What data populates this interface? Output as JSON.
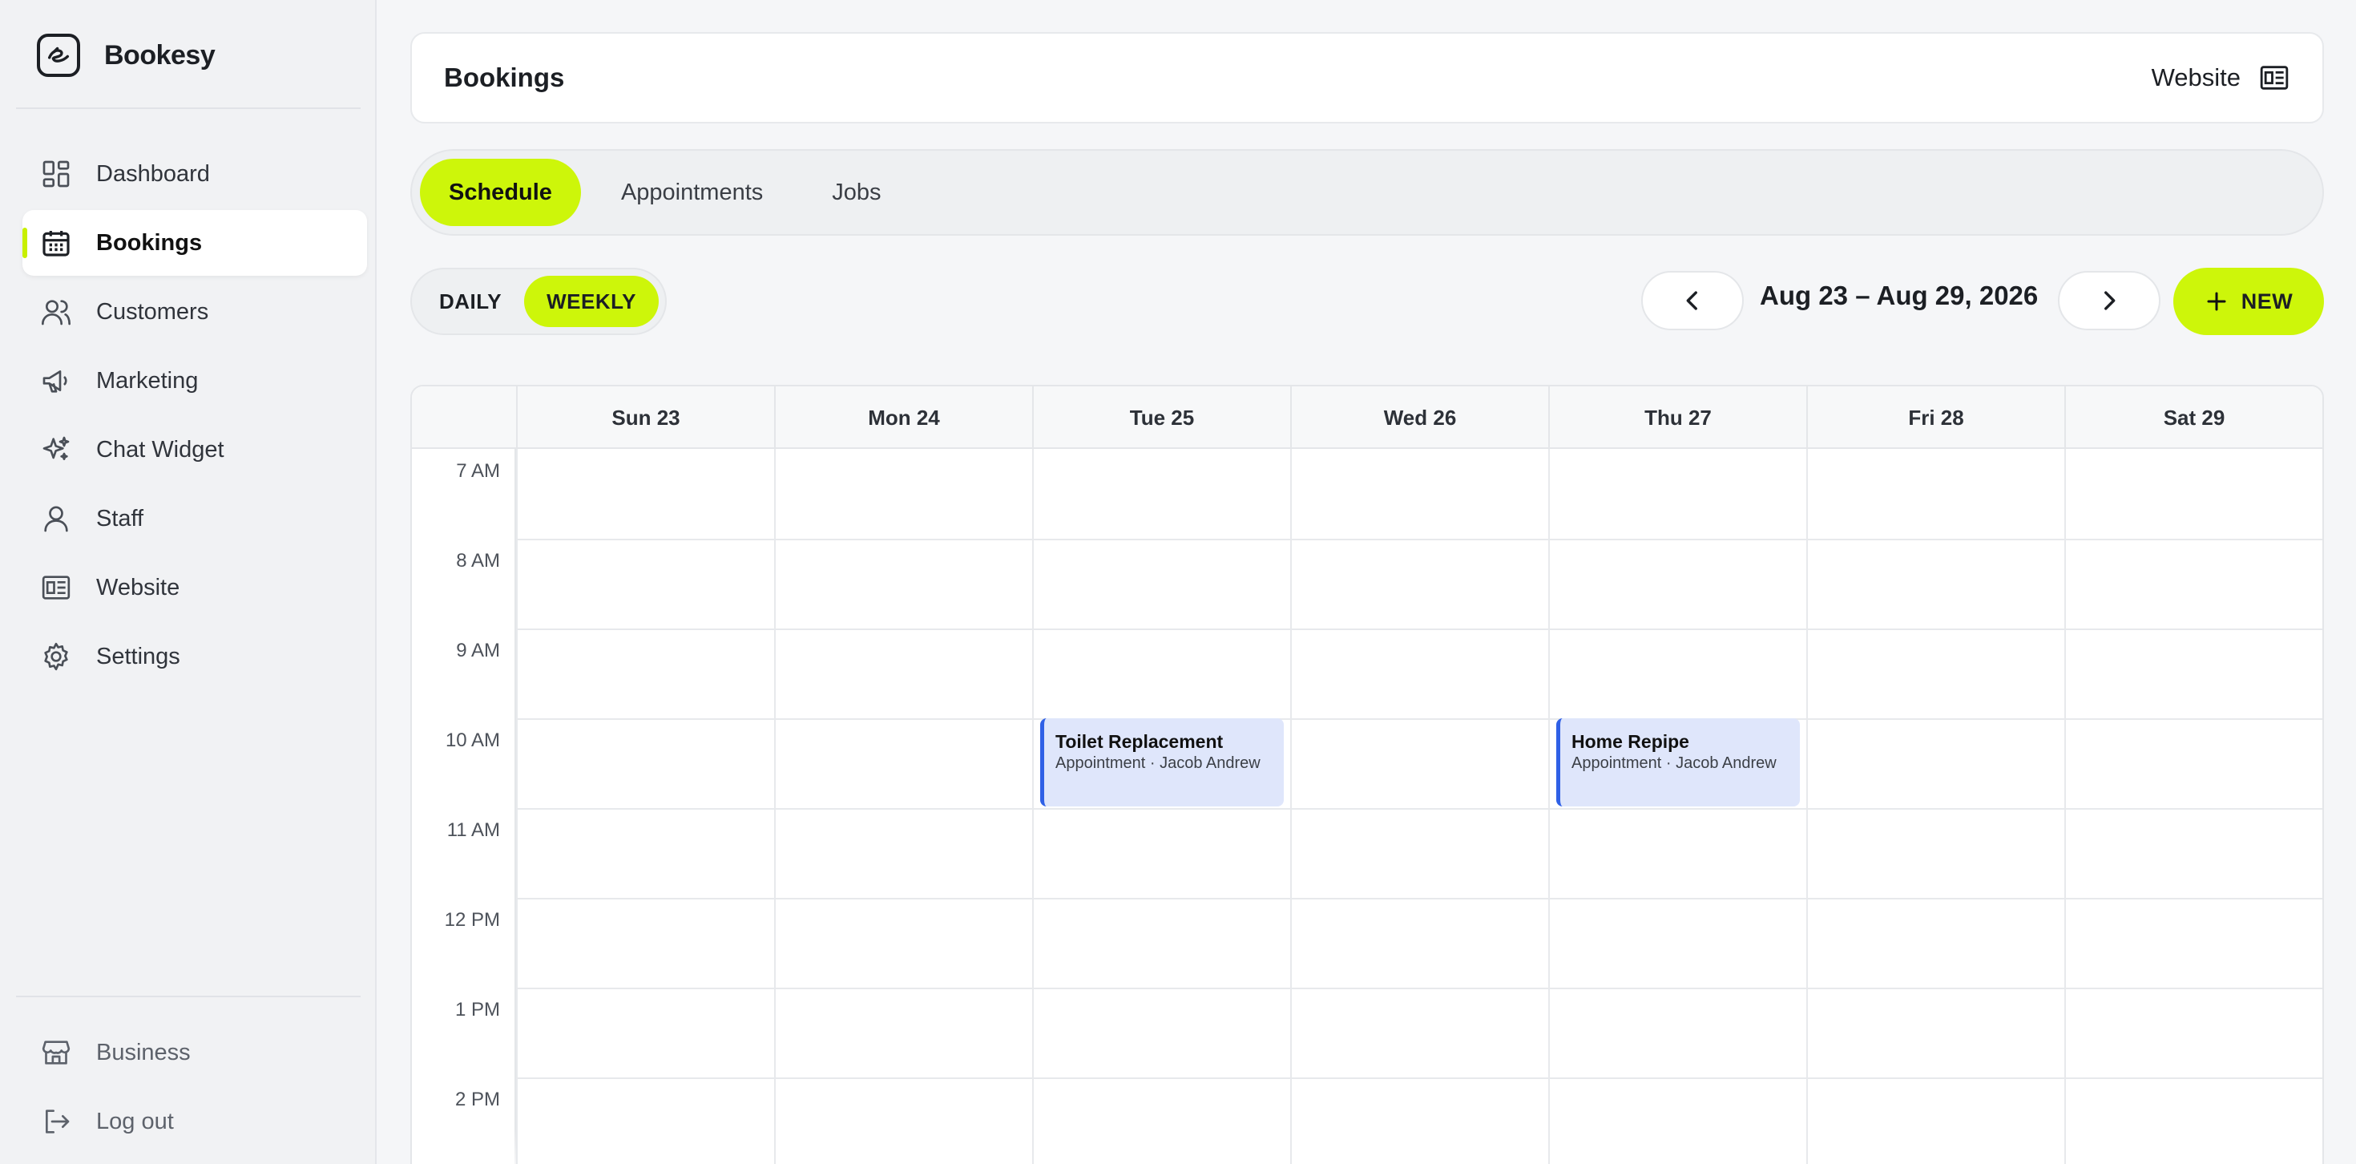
{
  "app": {
    "name": "Bookesy"
  },
  "sidebar": {
    "items": [
      {
        "label": "Dashboard",
        "icon": "dashboard-icon"
      },
      {
        "label": "Bookings",
        "icon": "calendar-icon",
        "active": true
      },
      {
        "label": "Customers",
        "icon": "users-icon"
      },
      {
        "label": "Marketing",
        "icon": "megaphone-icon"
      },
      {
        "label": "Chat Widget",
        "icon": "sparkles-icon"
      },
      {
        "label": "Staff",
        "icon": "user-icon"
      },
      {
        "label": "Website",
        "icon": "website-icon"
      },
      {
        "label": "Settings",
        "icon": "gear-icon"
      }
    ],
    "bottom": [
      {
        "label": "Business",
        "icon": "store-icon"
      },
      {
        "label": "Log out",
        "icon": "logout-icon"
      }
    ]
  },
  "header": {
    "title": "Bookings",
    "website_label": "Website"
  },
  "tabs": [
    {
      "label": "Schedule",
      "active": true
    },
    {
      "label": "Appointments"
    },
    {
      "label": "Jobs"
    }
  ],
  "view_toggle": {
    "daily": "DAILY",
    "weekly": "WEEKLY",
    "active": "weekly"
  },
  "date_range": "Aug 23 – Aug 29, 2026",
  "new_button": "NEW",
  "calendar": {
    "days": [
      "Sun 23",
      "Mon 24",
      "Tue 25",
      "Wed 26",
      "Thu 27",
      "Fri 28",
      "Sat 29"
    ],
    "hours": [
      "7 AM",
      "8 AM",
      "9 AM",
      "10 AM",
      "11 AM",
      "12 PM",
      "1 PM",
      "2 PM"
    ],
    "events": [
      {
        "title": "Toilet Replacement",
        "subtitle": "Appointment · Jacob Andrew",
        "day": "Tue 25",
        "start": "10 AM"
      },
      {
        "title": "Home Repipe",
        "subtitle": "Appointment · Jacob Andrew",
        "day": "Thu 27",
        "start": "10 AM"
      }
    ]
  },
  "colors": {
    "accent": "#cdf60a",
    "event_bg": "#dfe6fb",
    "event_border": "#2f60e6"
  }
}
